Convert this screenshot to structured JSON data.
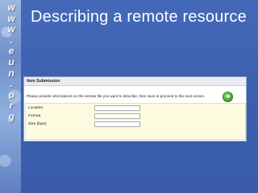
{
  "slide": {
    "title": "Describing a remote resource",
    "side_text": [
      "w",
      "w",
      "w",
      ".",
      "e",
      "u",
      "n",
      ".",
      "o",
      "r",
      "g"
    ]
  },
  "form": {
    "header": "Item Submission",
    "intro": "Please provide informations on the remote file you want to describe, then save to proceed to the next screen.",
    "go_button_icon": "arrow-right-icon",
    "fields": [
      {
        "label": "Location",
        "separator": ":",
        "value": ""
      },
      {
        "label": "Format",
        "separator": ":",
        "value": ""
      },
      {
        "label": "Size [byte]",
        "separator": ":",
        "value": ""
      }
    ]
  },
  "colors": {
    "slide_background": "#3e63b2",
    "title_text": "#ffffff",
    "form_field_area": "#fdfbe0",
    "go_button": "#3aa32b"
  }
}
